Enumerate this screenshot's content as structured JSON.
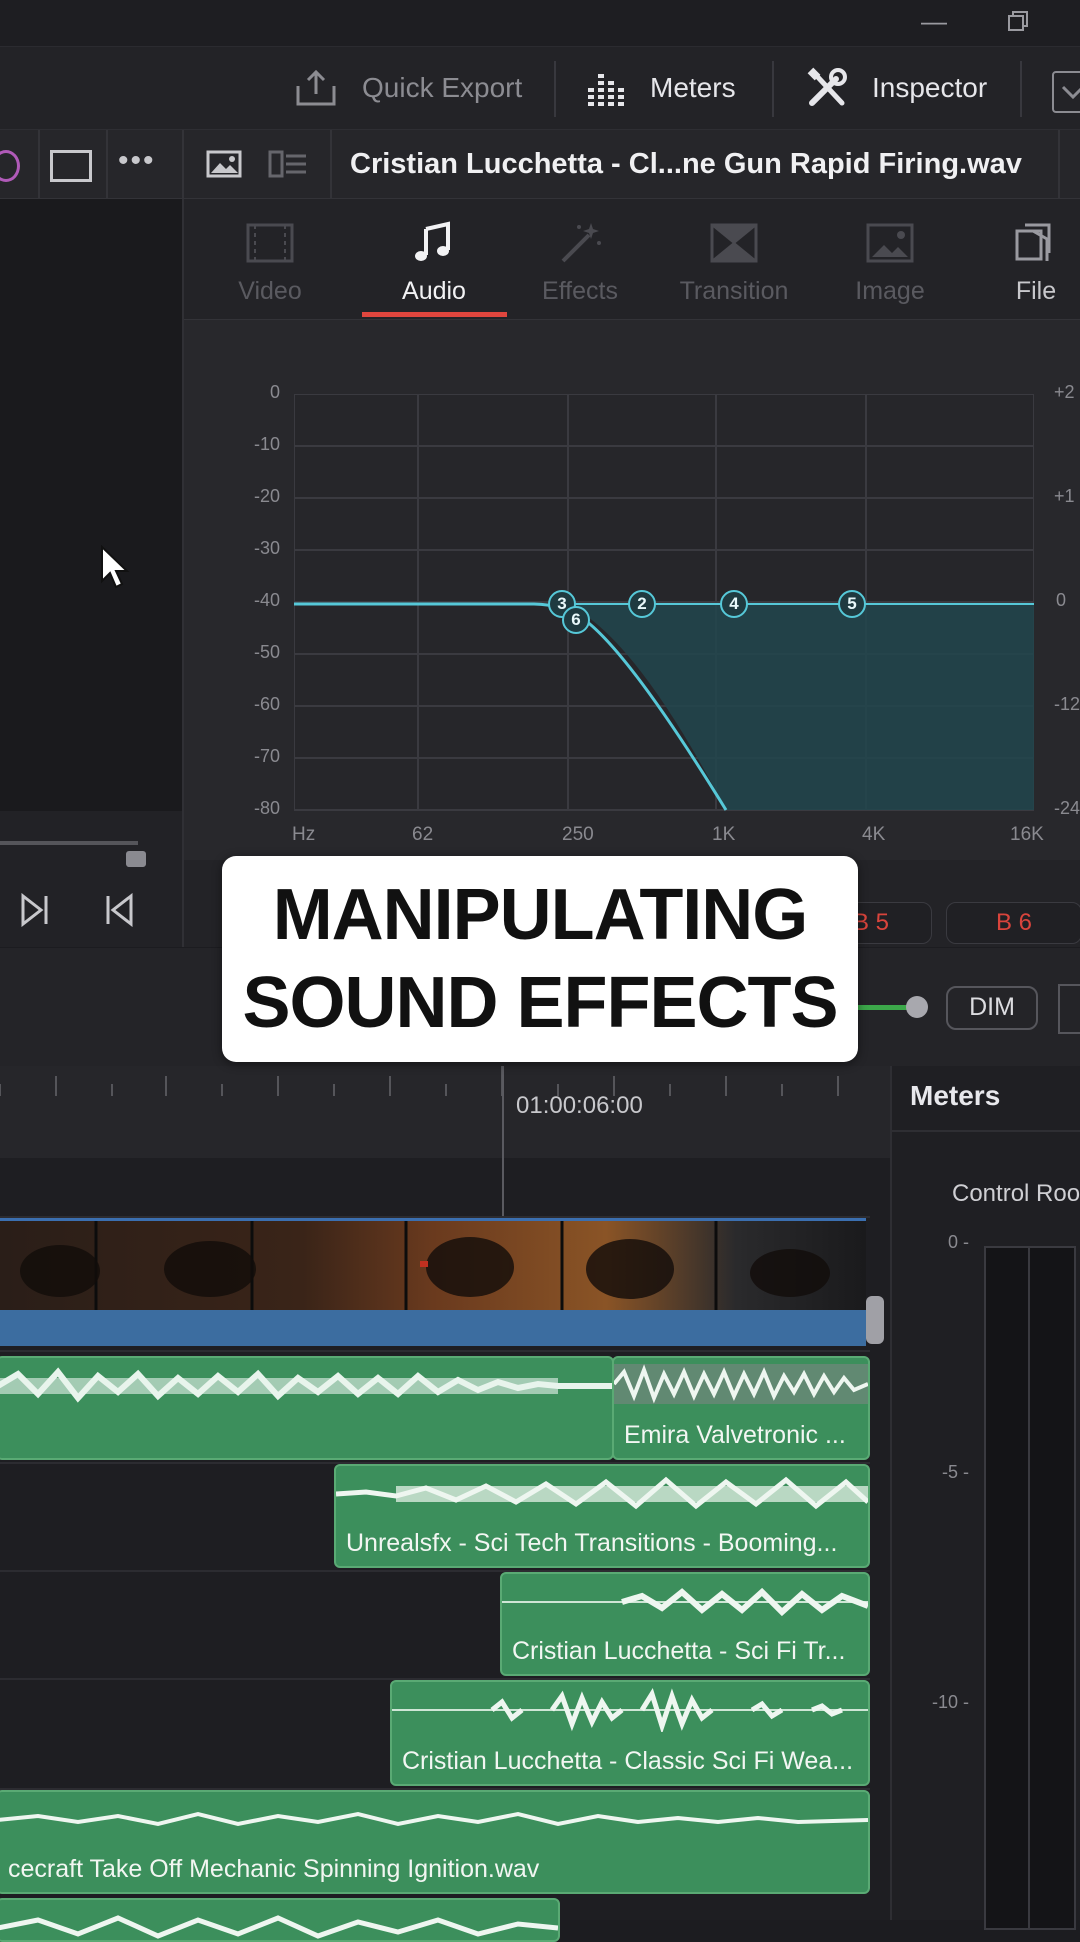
{
  "toolbar": {
    "quick_export": "Quick Export",
    "meters": "Meters",
    "inspector": "Inspector"
  },
  "clip_header": {
    "clip_name": "Cristian Lucchetta - Cl...ne Gun Rapid Firing.wav"
  },
  "inspector_tabs": [
    {
      "label": "Video",
      "icon": "film-icon",
      "active": false
    },
    {
      "label": "Audio",
      "icon": "music-note-icon",
      "active": true
    },
    {
      "label": "Effects",
      "icon": "magic-wand-icon",
      "active": false
    },
    {
      "label": "Transition",
      "icon": "transition-icon",
      "active": false
    },
    {
      "label": "Image",
      "icon": "image-icon",
      "active": false
    },
    {
      "label": "File",
      "icon": "file-icon",
      "active": false
    }
  ],
  "eq": {
    "y_labels": [
      "0",
      "-10",
      "-20",
      "-30",
      "-40",
      "-50",
      "-60",
      "-70",
      "-80"
    ],
    "y_labels_right": [
      "+2",
      "+1",
      "0",
      "-12",
      "-24"
    ],
    "x_labels": [
      "Hz",
      "62",
      "250",
      "1K",
      "4K",
      "16K"
    ],
    "nodes": [
      "3",
      "6",
      "2",
      "4",
      "5"
    ]
  },
  "buses": [
    "B 5",
    "B 6"
  ],
  "caption": {
    "line1": "MANIPULATING",
    "line2": "SOUND EFFECTS"
  },
  "monitor": {
    "dim": "DIM"
  },
  "timeline": {
    "timecode": "01:00:06:00",
    "clips": [
      {
        "name": "Emira Valvetronic ..."
      },
      {
        "name": "Unrealsfx - Sci Tech Transitions - Booming..."
      },
      {
        "name": "Cristian Lucchetta - Sci Fi Tr..."
      },
      {
        "name": "Cristian Lucchetta - Classic Sci Fi Wea..."
      },
      {
        "name": "cecraft Take Off Mechanic Spinning Ignition.wav"
      }
    ]
  },
  "meters_panel": {
    "title": "Meters",
    "subtitle": "Control Roo",
    "ticks": [
      "0 -",
      "-5 -",
      "-10 -"
    ]
  },
  "colors": {
    "accent_red": "#e0463e",
    "eq_curve": "#56c8d8",
    "audio_clip": "#3c8f5c",
    "video_track_border": "#3b6fb0"
  }
}
